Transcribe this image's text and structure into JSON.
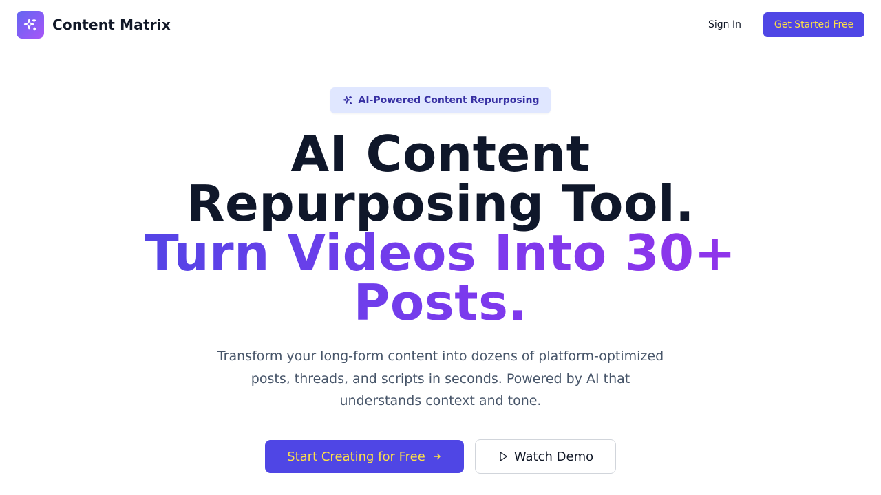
{
  "nav": {
    "brand": "Content Matrix",
    "logo_icon": "sparkles-icon",
    "sign_in": "Sign In",
    "get_started": "Get Started Free"
  },
  "hero": {
    "badge": {
      "icon": "sparkles-icon",
      "label": "AI-Powered Content Repurposing"
    },
    "headline_line1": "AI Content",
    "headline_line2": "Repurposing Tool.",
    "headline_accent_line1": "Turn Videos Into 30+",
    "headline_accent_line2": "Posts.",
    "subtitle": "Transform your long-form content into dozens of platform-optimized posts, threads, and scripts in seconds. Powered by AI that understands context and tone.",
    "primary_cta": "Start Creating for Free",
    "primary_cta_icon": "arrow-right-icon",
    "secondary_cta": "Watch Demo",
    "secondary_cta_icon": "play-icon"
  },
  "colors": {
    "brand": "#4f46e5",
    "accent_text": "#fde047",
    "gradient_start": "#4f46e5",
    "gradient_end": "#9333ea",
    "badge_bg": "#e0e7ff",
    "badge_text": "#3730a3"
  }
}
